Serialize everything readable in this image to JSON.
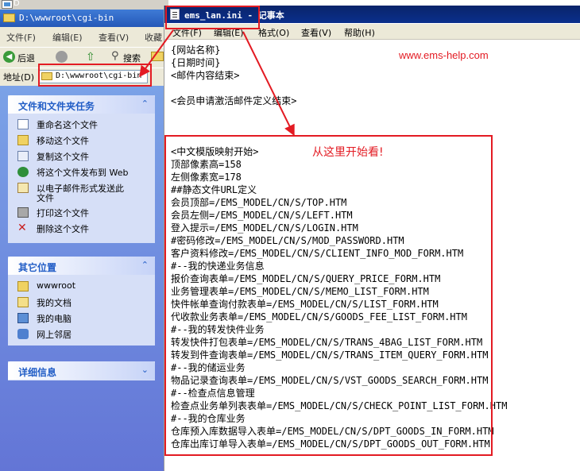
{
  "desktop": {
    "label": "D"
  },
  "explorer": {
    "title": "D:\\wwwroot\\cgi-bin",
    "menu": [
      "文件(F)",
      "编辑(E)",
      "查看(V)",
      "收藏"
    ],
    "toolbar": {
      "back": "后退",
      "search": "搜索"
    },
    "address": {
      "label": "地址(D)",
      "value": "D:\\wwwroot\\cgi-bin"
    },
    "file_tasks": {
      "title": "文件和文件夹任务",
      "items": [
        {
          "label": "重命名这个文件",
          "icon": "rename-icon"
        },
        {
          "label": "移动这个文件",
          "icon": "move-icon"
        },
        {
          "label": "复制这个文件",
          "icon": "copy-icon"
        },
        {
          "label": "将这个文件发布到 Web",
          "icon": "web-publish-icon"
        },
        {
          "label": "以电子邮件形式发送此",
          "label2": "文件",
          "icon": "email-icon"
        },
        {
          "label": "打印这个文件",
          "icon": "print-icon"
        },
        {
          "label": "删除这个文件",
          "icon": "delete-icon"
        }
      ]
    },
    "other_places": {
      "title": "其它位置",
      "items": [
        {
          "label": "wwwroot",
          "icon": "folder-icon"
        },
        {
          "label": "我的文档",
          "icon": "my-documents-icon"
        },
        {
          "label": "我的电脑",
          "icon": "my-computer-icon"
        },
        {
          "label": "网上邻居",
          "icon": "network-icon"
        }
      ]
    },
    "details": {
      "title": "详细信息"
    }
  },
  "notepad": {
    "title": "ems_lan.ini - 记事本",
    "menu": [
      "文件(F)",
      "编辑(E)",
      "格式(O)",
      "查看(V)",
      "帮助(H)"
    ],
    "lines_top": [
      "{网站名称}",
      "{日期时间}",
      "<邮件内容结束>",
      "",
      "<会员申请激活邮件定义结束>"
    ],
    "lines_main": [
      "<中文模版映射开始>",
      "顶部像素高=158",
      "左侧像素宽=178",
      "##静态文件URL定义",
      "会员顶部=/EMS_MODEL/CN/S/TOP.HTM",
      "会员左侧=/EMS_MODEL/CN/S/LEFT.HTM",
      "登入提示=/EMS_MODEL/CN/S/LOGIN.HTM",
      "#密码修改=/EMS_MODEL/CN/S/MOD_PASSWORD.HTM",
      "客户资料修改=/EMS_MODEL/CN/S/CLIENT_INFO_MOD_FORM.HTM",
      "#--我的快递业务信息",
      "报价查询表单=/EMS_MODEL/CN/S/QUERY_PRICE_FORM.HTM",
      "业务管理表单=/EMS_MODEL/CN/S/MEMO_LIST_FORM.HTM",
      "快件帐单查询付款表单=/EMS_MODEL/CN/S/LIST_FORM.HTM",
      "代收款业务表单=/EMS_MODEL/CN/S/GOODS_FEE_LIST_FORM.HTM",
      "#--我的转发快件业务",
      "转发快件打包表单=/EMS_MODEL/CN/S/TRANS_4BAG_LIST_FORM.HTM",
      "转发到件查询表单=/EMS_MODEL/CN/S/TRANS_ITEM_QUERY_FORM.HTM",
      "#--我的储运业务",
      "物品记录查询表单=/EMS_MODEL/CN/S/VST_GOODS_SEARCH_FORM.HTM",
      "#--检查点信息管理",
      "检查点业务单列表表单=/EMS_MODEL/CN/S/CHECK_POINT_LIST_FORM.HTM",
      "#--我的仓库业务",
      "仓库预入库数据导入表单=/EMS_MODEL/CN/S/DPT_GOODS_IN_FORM.HTM",
      "仓库出库订单导入表单=/EMS_MODEL/CN/S/DPT_GOODS_OUT_FORM.HTM"
    ]
  },
  "annotations": {
    "watermark": "www.ems-help.com",
    "callout": "从这里开始看!",
    "color": "#e31b23"
  }
}
